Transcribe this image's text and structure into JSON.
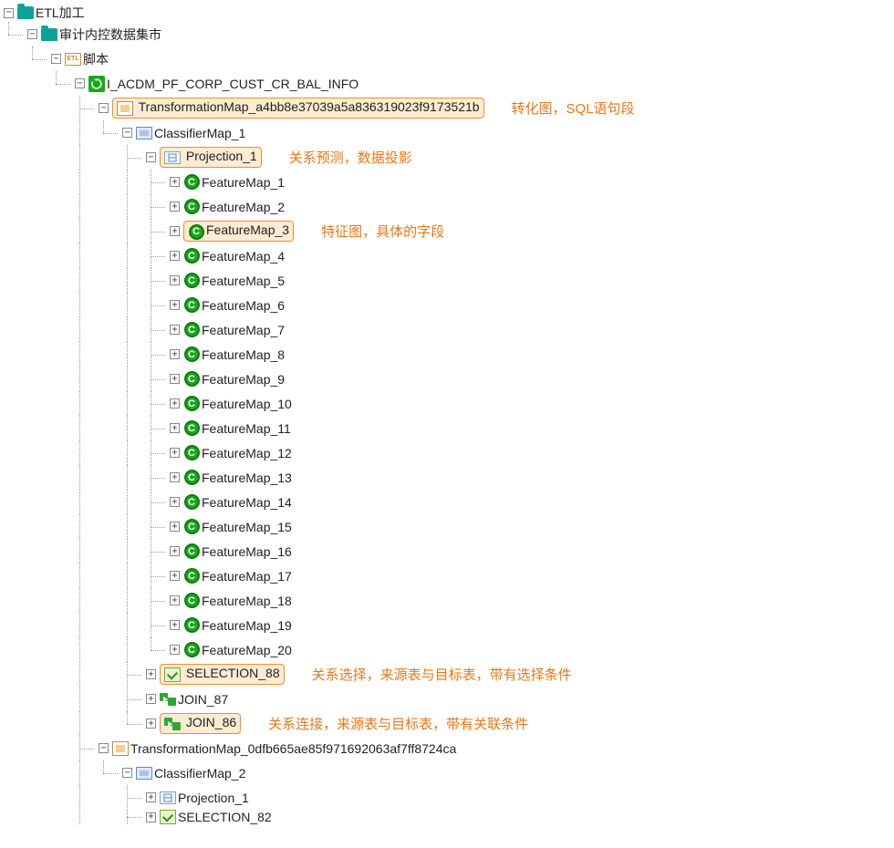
{
  "tree": {
    "root": {
      "label": "ETL加工"
    },
    "l1": {
      "label": "审计内控数据集市"
    },
    "l2": {
      "label": "脚本",
      "etl_tag": "ETL"
    },
    "l3": {
      "label": "I_ACDM_PF_CORP_CUST_CR_BAL_INFO"
    },
    "tmap1": {
      "label": "TransformationMap_a4bb8e37039a5a836319023f9173521b"
    },
    "cmap1": {
      "label": "ClassifierMap_1"
    },
    "proj1": {
      "label": "Projection_1"
    },
    "features": [
      "FeatureMap_1",
      "FeatureMap_2",
      "FeatureMap_3",
      "FeatureMap_4",
      "FeatureMap_5",
      "FeatureMap_6",
      "FeatureMap_7",
      "FeatureMap_8",
      "FeatureMap_9",
      "FeatureMap_10",
      "FeatureMap_11",
      "FeatureMap_12",
      "FeatureMap_13",
      "FeatureMap_14",
      "FeatureMap_15",
      "FeatureMap_16",
      "FeatureMap_17",
      "FeatureMap_18",
      "FeatureMap_19",
      "FeatureMap_20"
    ],
    "sel88": {
      "label": "SELECTION_88"
    },
    "join87": {
      "label": "JOIN_87"
    },
    "join86": {
      "label": "JOIN_86"
    },
    "tmap2": {
      "label": "TransformationMap_0dfb665ae85f971692063af7ff8724ca"
    },
    "cmap2": {
      "label": "ClassifierMap_2"
    },
    "proj2": {
      "label": "Projection_1"
    },
    "sel82": {
      "label": "SELECTION_82"
    }
  },
  "annotations": {
    "tmap": "转化图，SQL语句段",
    "proj": "关系预测，数据投影",
    "feature": "特征图，具体的字段",
    "selection": "关系选择，来源表与目标表，带有选择条件",
    "join": "关系连接，来源表与目标表，带有关联条件"
  },
  "symbols": {
    "minus": "−",
    "plus": "+"
  }
}
